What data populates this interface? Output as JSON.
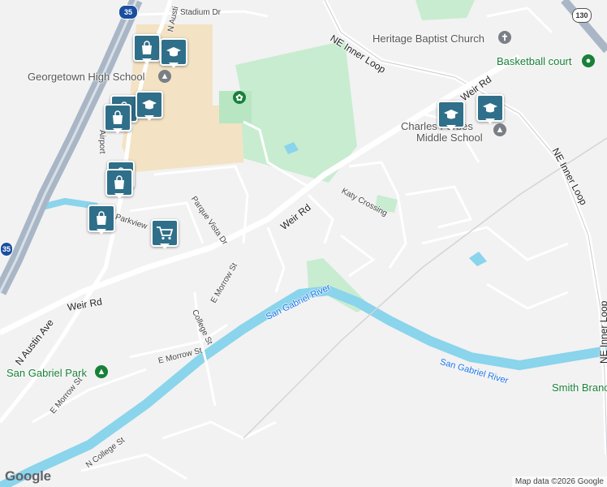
{
  "map": {
    "attribution": {
      "logo": "Google",
      "map_data": "Map data ©2026 Google"
    },
    "roads": {
      "weir_rd_1": "Weir Rd",
      "weir_rd_2": "Weir Rd",
      "weir_rd_3": "Weir Rd",
      "ne_inner_loop_1": "NE Inner Loop",
      "ne_inner_loop_2": "NE Inner Loop",
      "ne_inner_loop_3": "NE Inner Loop",
      "n_austin_ave_1": "N Austin Ave",
      "n_austin_top": "N Austi",
      "stadium_dr": "Stadium Dr",
      "katy_crossing": "Katy Crossing",
      "parque_vista_dr": "Parque Vista Dr",
      "e_morrow_st_1": "E Morrow St",
      "e_morrow_st_2": "E Morrow St",
      "e_morrow_st_3": "E Morrow St",
      "college_st": "College St",
      "n_college_st": "N College St",
      "parkview": "Parkview",
      "airport": "Airport"
    },
    "water": {
      "san_gabriel_river_1": "San Gabriel River",
      "san_gabriel_river_2": "San Gabriel River"
    },
    "places": {
      "heritage_baptist": "Heritage Baptist Church",
      "basketball_court": "Basketball court",
      "georgetown_high": "Georgetown High School",
      "charles_forbes": "Charles Forbes",
      "middle_school": "Middle School",
      "san_gabriel_park": "San Gabriel Park",
      "smith_branch": "Smith Branc"
    },
    "highways": {
      "i35": "35",
      "i35_partial": "35",
      "r130": "130"
    },
    "markers": [
      {
        "kind": "shopping",
        "icon": "shopping-bag-icon"
      },
      {
        "kind": "school",
        "icon": "graduation-cap-icon"
      },
      {
        "kind": "shopping",
        "icon": "shopping-bag-icon"
      },
      {
        "kind": "school",
        "icon": "graduation-cap-icon"
      },
      {
        "kind": "shopping",
        "icon": "shopping-bag-icon"
      },
      {
        "kind": "shopping",
        "icon": "shopping-bag-icon"
      },
      {
        "kind": "shopping",
        "icon": "shopping-bag-icon"
      },
      {
        "kind": "grocery",
        "icon": "shopping-cart-icon"
      },
      {
        "kind": "school",
        "icon": "graduation-cap-icon"
      },
      {
        "kind": "school",
        "icon": "graduation-cap-icon"
      }
    ],
    "colors": {
      "marker": "#2f6f8a",
      "river": "#8ad4ec",
      "park": "#c8ecd0",
      "school_area": "#f3e3c4",
      "highway": "#a9b6c6"
    }
  }
}
